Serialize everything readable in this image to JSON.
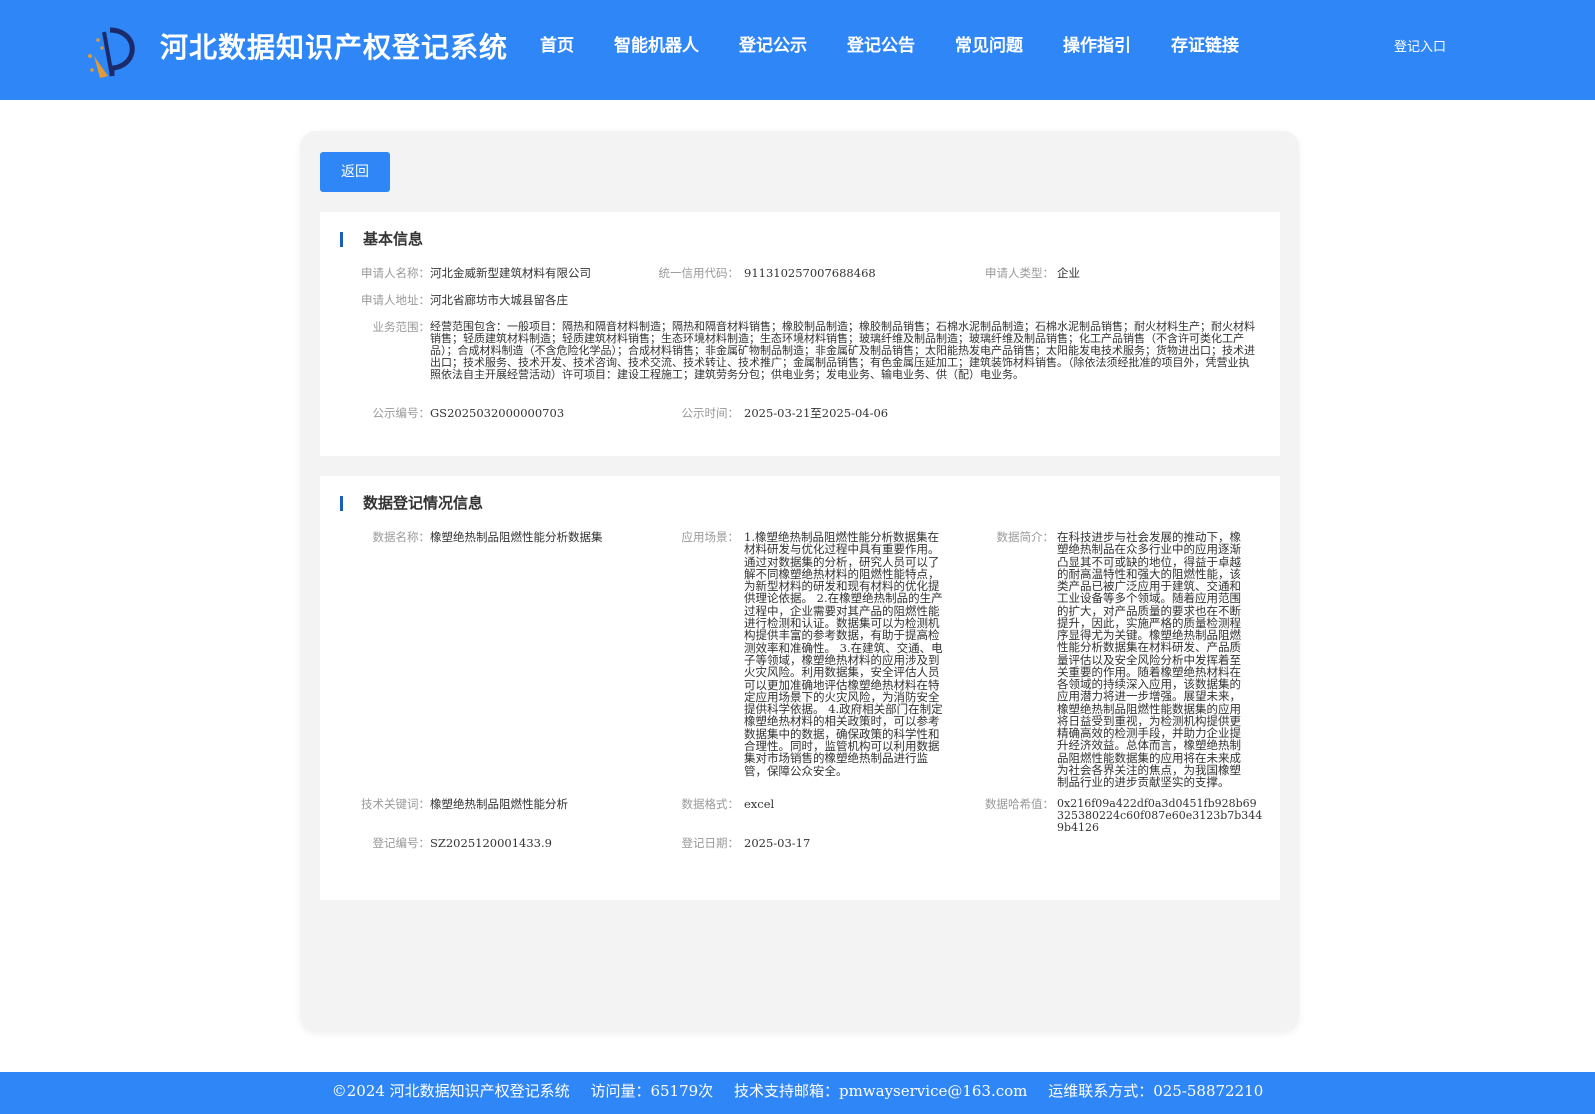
{
  "header": {
    "logo_icon": "pen-nib-logo-icon",
    "title": "河北数据知识产权登记系统",
    "nav": [
      "首页",
      "智能机器人",
      "登记公示",
      "登记公告",
      "常见问题",
      "操作指引",
      "存证链接"
    ],
    "login": "登记入口",
    "brand_color": "#2f86f6"
  },
  "back_button": "返回",
  "basic": {
    "title": "基本信息",
    "applicant_name_label": "申请人名称：",
    "applicant_name": "河北金威新型建筑材料有限公司",
    "credit_code_label": "统一信用代码：",
    "credit_code": "91131025700768846​8",
    "applicant_type_label": "申请人类型：",
    "applicant_type": "企业",
    "address_label": "申请人地址：",
    "address": "河北省廊坊市大城县留各庄",
    "scope_label": "业务范围：",
    "scope": "经营范围包含：一般项目：隔热和隔音材料制造；隔热和隔音材料销售；橡胶制品制造；橡胶制品销售；石棉水泥制品制造；石棉水泥制品销售；耐火材料生产；耐火材料销售；轻质建筑材料制造；轻质建筑材料销售；生态环境材料制造；生态环境材料销售；玻璃纤维及制品制造；玻璃纤维及制品销售；化工产品销售（不含许可类化工产品）；合成材料制造（不含危险化学品）；合成材料销售；非金属矿物制品制造；非金属矿及制品销售；太阳能热发电产品销售；太阳能发电技术服务；货物进出口；技术进出口；技术服务、技术开发、技术咨询、技术交流、技术转让、技术推广；金属制品销售；有色金属压延加工；建筑装饰材料销售。（除依法须经批准的项目外，凭营业执照依法自主开展经营活动）许可项目：建设工程施工；建筑劳务分包；供电业务；发电业务、输电业务、供（配）电业务。",
    "notice_no_label": "公示编号：",
    "notice_no": "GS2025032000000703",
    "notice_time_label": "公示时间：",
    "notice_time": "2025-03-21至2025-04-06"
  },
  "registration": {
    "title": "数据登记情况信息",
    "data_name_label": "数据名称：",
    "data_name": "橡塑绝热制品阻燃性能分析数据集",
    "scenario_label": "应用场景：",
    "scenario": "1.橡塑绝热制品阻燃性能分析数据集在材料研发与优化过程中具有重要作用。通过对数据集的分析，研究人员可以了解不同橡塑绝热材料的阻燃性能特点，为新型材料的研发和现有材料的优化提供理论依据。 2.在橡塑绝热制品的生产过程中，企业需要对其产品的阻燃性能进行检测和认证。数据集可以为检测机构提供丰富的参考数据，有助于提高检测效率和准确性。 3.在建筑、交通、电子等领域，橡塑绝热材料的应用涉及到火灾风险。利用数据集，安全评估人员可以更加准确地评估橡塑绝热材料在特定应用场景下的火灾风险，为消防安全提供科学依据。 4.政府相关部门在制定橡塑绝热材料的相关政策时，可以参考数据集中的数据，确保政策的科学性和合理性。同时，监管机构可以利用数据集对市场销售的橡塑绝热制品进行监管，保障公众安全。",
    "intro_label": "数据简介：",
    "intro": "在科技进步与社会发展的推动下，橡塑绝热制品在众多行业中的应用逐渐凸显其不可或缺的地位，得益于卓越的耐高温特性和强大的阻燃性能，该类产品已被广泛应用于建筑、交通和工业设备等多个领域。随着应用范围的扩大，对产品质量的要求也在不断提升，因此，实施严格的质量检测程序显得尤为关键。橡塑绝热制品阻燃性能分析数据集在材料研发、产品质量评估以及安全风险分析中发挥着至关重要的作用。随着橡塑绝热材料在各领域的持续深入应用，该数据集的应用潜力将进一步增强。展望未来，橡塑绝热制品阻燃性能数据集的应用将日益受到重视，为检测机构提供更精确高效的检测手段，并助力企业提升经济效益。总体而言，橡塑绝热制品阻燃性能数据集的应用将在未来成为社会各界关注的焦点，为我国橡塑制品行业的进步贡献坚实的支撑。",
    "keyword_label": "技术关键词：",
    "keyword": "橡塑绝热制品阻燃性能分析",
    "format_label": "数据格式：",
    "format": "excel",
    "hash_label": "数据哈希值：",
    "hash": "0x216f09a422df0a3d0451fb928b69325380224c60f087e60e3123b7b3449b4126",
    "reg_no_label": "登记编号：",
    "reg_no": "SZ2025120001433.9",
    "reg_date_label": "登记日期：",
    "reg_date": "2025-03-17"
  },
  "footer": {
    "copyright": "©2024 河北数据知识产权登记系统",
    "visits": "访问量：65179次",
    "email": "技术支持邮箱：pmwayservice@163.com",
    "phone": "运维联系方式：025-58872210"
  }
}
